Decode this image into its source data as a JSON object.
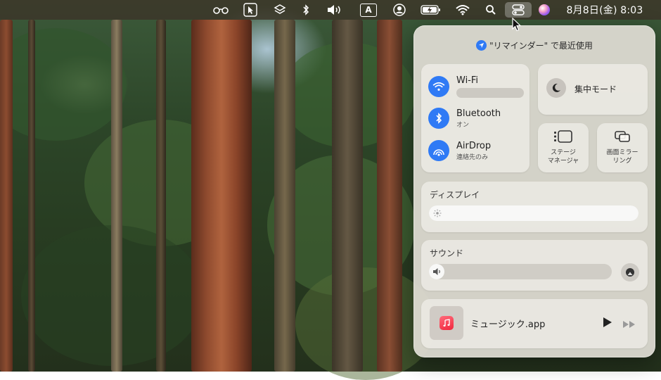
{
  "menubar": {
    "icons": [
      "accessibility-glasses-icon",
      "pointer-icon",
      "layers-icon",
      "bluetooth-icon",
      "volume-icon",
      "input-source-icon",
      "user-icon",
      "battery-icon",
      "wifi-icon",
      "search-icon",
      "control-center-icon",
      "siri-icon"
    ],
    "input_source_label": "A",
    "datetime": "8月8日(金)  8:03"
  },
  "control_center": {
    "location_banner": "\"リマインダー\" で最近使用",
    "network": {
      "wifi": {
        "title": "Wi-Fi",
        "subtitle": ""
      },
      "bluetooth": {
        "title": "Bluetooth",
        "subtitle": "オン"
      },
      "airdrop": {
        "title": "AirDrop",
        "subtitle": "連絡先のみ"
      }
    },
    "focus": {
      "label": "集中モード"
    },
    "stage_manager": {
      "line1": "ステージ",
      "line2": "マネージャ"
    },
    "screen_mirroring": {
      "line1": "画面ミラー",
      "line2": "リング"
    },
    "display": {
      "title": "ディスプレイ",
      "brightness_level": 1.0
    },
    "sound": {
      "title": "サウンド",
      "volume_level": 0.07
    },
    "now_playing": {
      "app": "ミュージック.app"
    }
  },
  "colors": {
    "accent": "#2f7af5",
    "music": "#f0283d",
    "menubar": "#3c3428"
  }
}
